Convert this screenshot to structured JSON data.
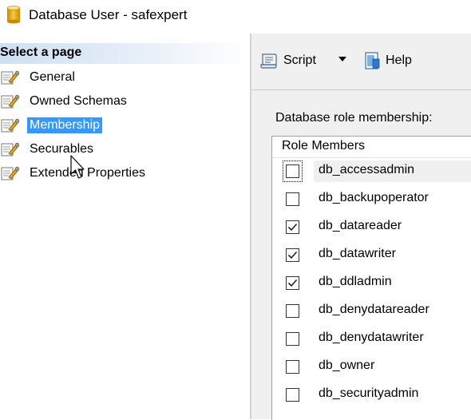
{
  "window": {
    "title": "Database User - safexpert"
  },
  "left_pane": {
    "header": "Select a page",
    "items": [
      {
        "label": "General",
        "icon": "page-wrench-icon",
        "selected": false
      },
      {
        "label": "Owned Schemas",
        "icon": "page-wrench-icon",
        "selected": false
      },
      {
        "label": "Membership",
        "icon": "page-wrench-icon",
        "selected": true
      },
      {
        "label": "Securables",
        "icon": "page-wrench-icon",
        "selected": false
      },
      {
        "label": "Extended Properties",
        "icon": "page-wrench-icon",
        "selected": false
      }
    ]
  },
  "toolbar": {
    "script_label": "Script",
    "script_icon": "script-icon",
    "dropdown_icon": "chevron-down-icon",
    "help_label": "Help",
    "help_icon": "help-icon"
  },
  "membership": {
    "section_label": "Database role membership:",
    "column_header": "Role Members",
    "roles": [
      {
        "name": "db_accessadmin",
        "checked": false,
        "focused": true
      },
      {
        "name": "db_backupoperator",
        "checked": false,
        "focused": false
      },
      {
        "name": "db_datareader",
        "checked": true,
        "focused": false
      },
      {
        "name": "db_datawriter",
        "checked": true,
        "focused": false
      },
      {
        "name": "db_ddladmin",
        "checked": true,
        "focused": false
      },
      {
        "name": "db_denydatareader",
        "checked": false,
        "focused": false
      },
      {
        "name": "db_denydatawriter",
        "checked": false,
        "focused": false
      },
      {
        "name": "db_owner",
        "checked": false,
        "focused": false
      },
      {
        "name": "db_securityadmin",
        "checked": false,
        "focused": false
      }
    ]
  },
  "colors": {
    "selected_bg": "#3399ff",
    "header_gradient_start": "#cfe0f3",
    "pane_bg": "#f0f0f0"
  }
}
